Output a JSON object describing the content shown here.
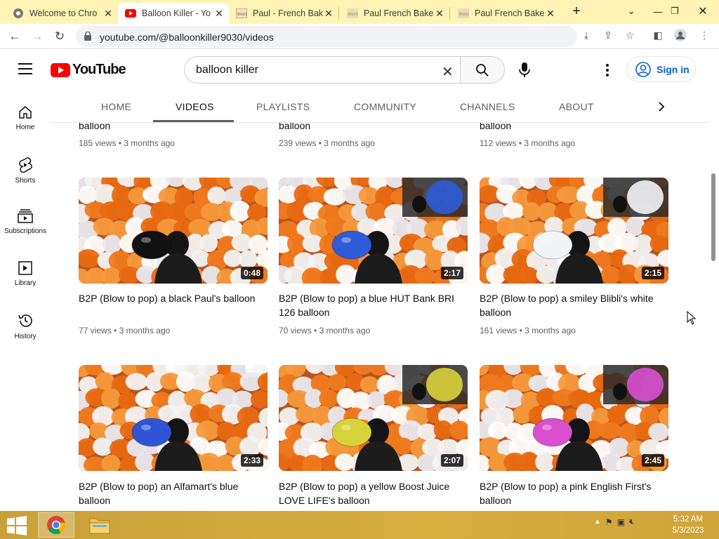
{
  "browser": {
    "tabs": [
      {
        "title": "Welcome to Chro",
        "icon": "chrome-icon"
      },
      {
        "title": "Balloon Killer - Yo",
        "icon": "youtube-icon",
        "active": true
      },
      {
        "title": "Paul - French Bak",
        "icon": "paul-favicon"
      },
      {
        "title": "Paul French Baker",
        "icon": "paul-favicon"
      },
      {
        "title": "Paul French Baker",
        "icon": "paul-favicon"
      }
    ],
    "new_tab_label": "+",
    "url": "youtube.com/@balloonkiller9030/videos"
  },
  "youtube": {
    "logo_text": "YouTube",
    "search_value": "balloon killer",
    "sign_in_label": "Sign in",
    "sidebar": [
      {
        "label": "Home",
        "icon": "home-icon"
      },
      {
        "label": "Shorts",
        "icon": "shorts-icon"
      },
      {
        "label": "Subscriptions",
        "icon": "subscriptions-icon"
      },
      {
        "label": "Library",
        "icon": "library-icon"
      },
      {
        "label": "History",
        "icon": "history-icon"
      }
    ],
    "channel_tabs": [
      "HOME",
      "VIDEOS",
      "PLAYLISTS",
      "COMMUNITY",
      "CHANNELS",
      "ABOUT"
    ],
    "selected_tab": "VIDEOS",
    "partial_row": [
      {
        "title_tail": "balloon",
        "views": "185 views",
        "age": "3 months ago"
      },
      {
        "title_tail": "balloon",
        "views": "239 views",
        "age": "3 months ago"
      },
      {
        "title_tail": "balloon",
        "views": "112 views",
        "age": "3 months ago"
      }
    ],
    "videos": [
      {
        "title": "B2P (Blow to pop) a black Paul's balloon",
        "duration": "0:48",
        "views": "77 views",
        "age": "3 months ago",
        "balloon_color": "#111111"
      },
      {
        "title": "B2P (Blow to pop) a blue HUT Bank BRI 126 balloon",
        "duration": "2:17",
        "views": "70 views",
        "age": "3 months ago",
        "balloon_color": "#2e5bd8"
      },
      {
        "title": "B2P (Blow to pop) a smiley Blibli's white balloon",
        "duration": "2:15",
        "views": "161 views",
        "age": "3 months ago",
        "balloon_color": "#f2f4f8"
      },
      {
        "title": "B2P (Blow to pop) an Alfamart's blue balloon",
        "duration": "2:33",
        "views": "",
        "age": "",
        "balloon_color": "#2f55d6"
      },
      {
        "title": "B2P (Blow to pop) a yellow Boost Juice LOVE LIFE's balloon",
        "duration": "2:07",
        "views": "",
        "age": "",
        "balloon_color": "#d8d23a"
      },
      {
        "title": "B2P (Blow to pop) a pink English First's balloon",
        "duration": "2:45",
        "views": "",
        "age": "",
        "balloon_color": "#d94fd0"
      }
    ],
    "meta_separator": "•"
  },
  "taskbar": {
    "time": "5:32 AM",
    "date": "5/3/2023"
  },
  "colors": {
    "tabbar_bg": "#fff4b3",
    "youtube_red": "#ff0000",
    "link_blue": "#065fd4",
    "taskbar_gold": "#d7ae3e"
  }
}
